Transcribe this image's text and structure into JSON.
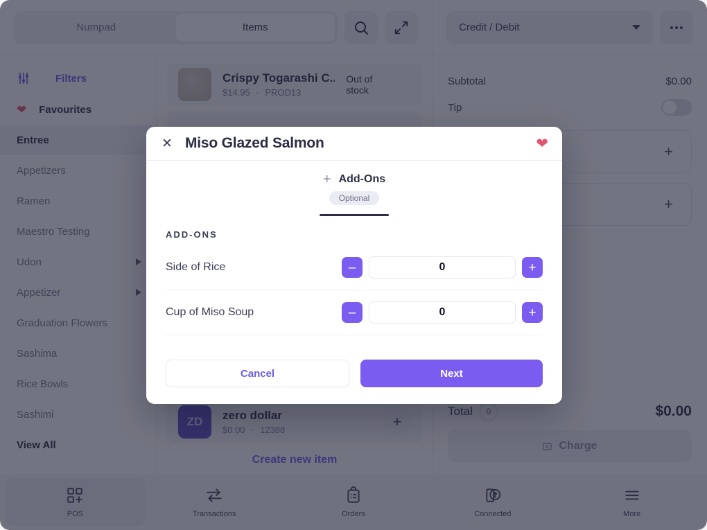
{
  "colors": {
    "accent": "#7b5cf0",
    "accent_link": "#6c5ce7",
    "heart": "#e0566f",
    "text_dark": "#2b2d42",
    "scrim": "rgba(31,33,54,0.62)"
  },
  "topbar": {
    "tabs": [
      {
        "label": "Numpad",
        "active": false
      },
      {
        "label": "Items",
        "active": true
      }
    ],
    "search_icon": "search-icon",
    "expand_icon": "expand-icon",
    "payment_select": {
      "value": "Credit / Debit"
    },
    "more_icon": "more-horizontal-icon"
  },
  "sidebar": {
    "filters": {
      "label": "Filters",
      "icon": "sliders-icon"
    },
    "favourites": {
      "label": "Favourites",
      "icon": "heart-icon"
    },
    "categories": [
      {
        "label": "Entree",
        "active": true,
        "has_arrow": false
      },
      {
        "label": "Appetizers",
        "active": false,
        "has_arrow": false
      },
      {
        "label": "Ramen",
        "active": false,
        "has_arrow": false
      },
      {
        "label": "Maestro Testing",
        "active": false,
        "has_arrow": false
      },
      {
        "label": "Udon",
        "active": false,
        "has_arrow": true
      },
      {
        "label": "Appetizer",
        "active": false,
        "has_arrow": true
      },
      {
        "label": "Graduation Flowers",
        "active": false,
        "has_arrow": false
      },
      {
        "label": "Sashima",
        "active": false,
        "has_arrow": false
      },
      {
        "label": "Rice Bowls",
        "active": false,
        "has_arrow": false
      },
      {
        "label": "Sashimi",
        "active": false,
        "has_arrow": false
      }
    ],
    "view_all": "View All"
  },
  "items": {
    "list": [
      {
        "name": "Crispy Togarashi C...",
        "price": "$14.95",
        "sku": "PROD13",
        "status": "Out of stock",
        "thumb_type": "image"
      },
      {
        "name": "zero dollar",
        "price": "$0.00",
        "sku": "12388",
        "status": "",
        "thumb_type": "mono",
        "initials": "ZD"
      }
    ],
    "separator": "·",
    "create_link": "Create new item"
  },
  "cart": {
    "subtotal_label": "Subtotal",
    "subtotal_value": "$0.00",
    "tip_label": "Tip",
    "tip_on": false,
    "placeholder_cards": [
      {
        "icon": "plus-icon"
      },
      {
        "icon": "plus-icon"
      }
    ],
    "total_label": "Total",
    "total_count": "0",
    "total_value": "$0.00",
    "charge_label": "Charge",
    "charge_icon": "cash-icon"
  },
  "bottom_nav": [
    {
      "label": "POS",
      "icon": "pos-grid-icon",
      "active": true
    },
    {
      "label": "Transactions",
      "icon": "transfer-arrows-icon",
      "active": false
    },
    {
      "label": "Orders",
      "icon": "clipboard-icon",
      "active": false
    },
    {
      "label": "Connected",
      "icon": "connected-usb-icon",
      "active": false
    },
    {
      "label": "More",
      "icon": "hamburger-icon",
      "active": false
    }
  ],
  "modal": {
    "close_icon": "close-icon",
    "title": "Miso Glazed Salmon",
    "favourite_icon": "heart-filled-icon",
    "favourite_on": true,
    "tab": {
      "plus_icon": "plus-icon",
      "name": "Add-Ons",
      "badge": "Optional"
    },
    "section_title": "ADD-ONS",
    "addons": [
      {
        "name": "Side of Rice",
        "qty": "0",
        "minus": "–",
        "plus": "+"
      },
      {
        "name": "Cup of Miso Soup",
        "qty": "0",
        "minus": "–",
        "plus": "+"
      }
    ],
    "cancel_label": "Cancel",
    "next_label": "Next"
  }
}
